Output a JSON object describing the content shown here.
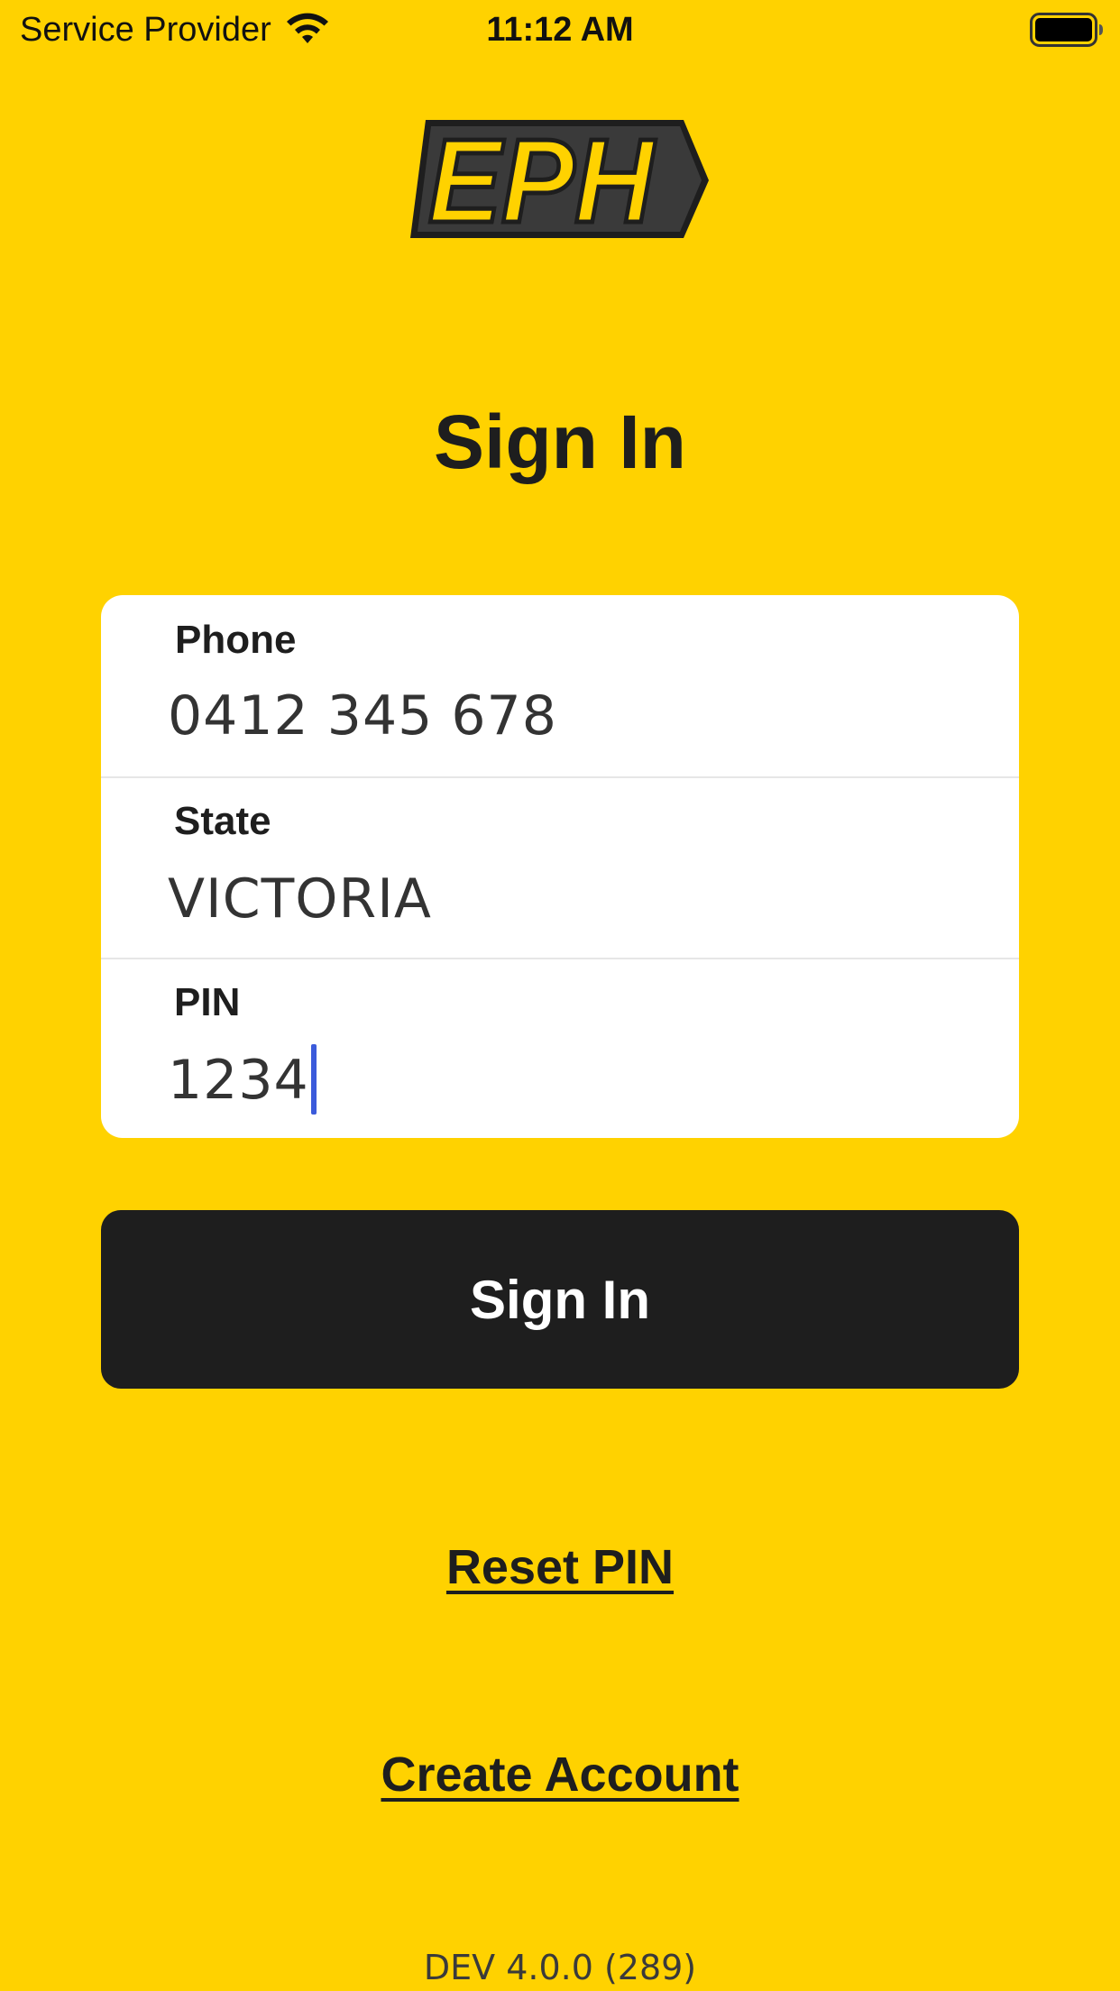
{
  "status_bar": {
    "carrier": "Service Provider",
    "time": "11:12 AM",
    "wifi_icon": "wifi-icon",
    "battery_icon": "battery-icon"
  },
  "logo": {
    "text": "EPH"
  },
  "page": {
    "title": "Sign In"
  },
  "form": {
    "phone": {
      "label": "Phone",
      "value": "0412 345 678"
    },
    "state": {
      "label": "State",
      "value": "VICTORIA"
    },
    "pin": {
      "label": "PIN",
      "value": "1234"
    }
  },
  "actions": {
    "sign_in": "Sign In",
    "reset_pin": "Reset PIN",
    "create_account": "Create Account"
  },
  "footer": {
    "version": "DEV 4.0.0 (289)"
  },
  "colors": {
    "background": "#FFD200",
    "button": "#1E1E1E",
    "card": "#FFFFFF",
    "caret": "#3B5BDB"
  }
}
